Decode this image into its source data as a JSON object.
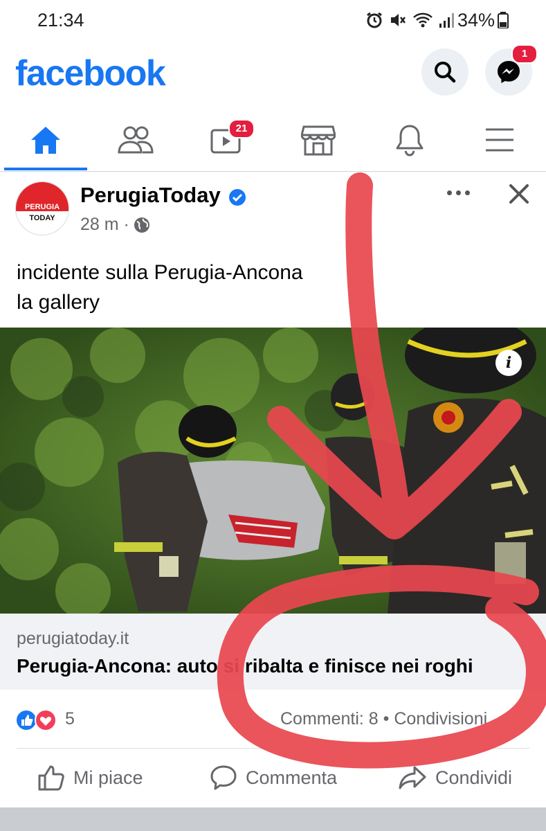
{
  "status_bar": {
    "time": "21:34",
    "battery_percent": "34%",
    "icons": [
      "alarm-icon",
      "mute-icon",
      "wifi-icon",
      "signal-icon",
      "battery-icon"
    ]
  },
  "header": {
    "logo_text": "facebook",
    "messenger_badge": "1"
  },
  "tabs": [
    {
      "name": "home",
      "icon": "home-icon",
      "active": true
    },
    {
      "name": "friends",
      "icon": "friends-icon",
      "active": false
    },
    {
      "name": "watch",
      "icon": "video-icon",
      "badge": "21",
      "active": false
    },
    {
      "name": "marketplace",
      "icon": "marketplace-icon",
      "active": false
    },
    {
      "name": "notifications",
      "icon": "bell-icon",
      "active": false
    },
    {
      "name": "menu",
      "icon": "menu-icon",
      "active": false
    }
  ],
  "post": {
    "avatar_line1": "PERUGIA",
    "avatar_line2": "TODAY",
    "page_name": "PerugiaToday",
    "time_ago": "28 m ·",
    "text_line1": "incidente sulla Perugia-Ancona",
    "text_line2": "la gallery",
    "link_domain": "perugiatoday.it",
    "link_title": "Perugia-Ancona: auto si ribalta e finisce nei roghi",
    "reaction_count": "5",
    "comments_shares": "Commenti: 8 • Condivisioni"
  },
  "actions": {
    "like": "Mi piace",
    "comment": "Commenta",
    "share": "Condividi"
  },
  "colors": {
    "brand_blue": "#1877f2",
    "badge_red": "#e41e3f",
    "annotation_red": "#e8474f"
  }
}
